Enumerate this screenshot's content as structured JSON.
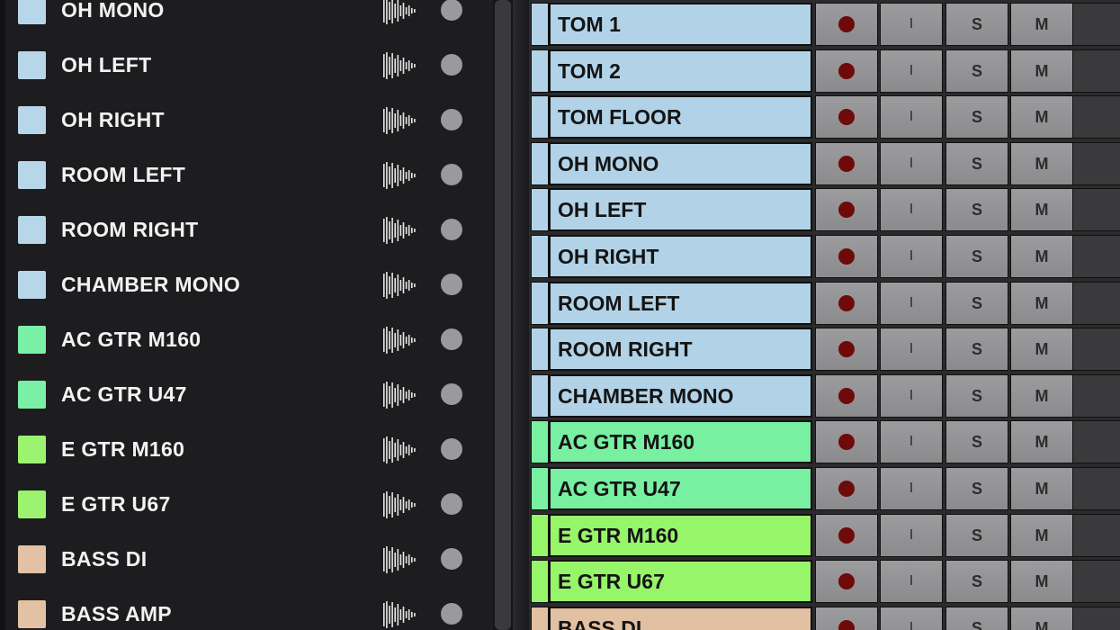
{
  "left_tracks": [
    {
      "name": "OH MONO",
      "color": "#b7d6ea"
    },
    {
      "name": "OH LEFT",
      "color": "#b7d6ea"
    },
    {
      "name": "OH RIGHT",
      "color": "#b7d6ea"
    },
    {
      "name": "ROOM LEFT",
      "color": "#b7d6ea"
    },
    {
      "name": "ROOM RIGHT",
      "color": "#b7d6ea"
    },
    {
      "name": "CHAMBER MONO",
      "color": "#b7d6ea"
    },
    {
      "name": "AC GTR M160",
      "color": "#79f0a6"
    },
    {
      "name": "AC GTR U47",
      "color": "#79f0a6"
    },
    {
      "name": "E GTR M160",
      "color": "#9bf36f"
    },
    {
      "name": "E GTR U67",
      "color": "#9bf36f"
    },
    {
      "name": "BASS DI",
      "color": "#e3c1a4"
    },
    {
      "name": "BASS AMP",
      "color": "#e3c1a4"
    }
  ],
  "left_icons": {
    "waveform": "waveform-icon",
    "status": "status-dot-icon"
  },
  "mixer_tracks": [
    {
      "name": "TOM 1",
      "color": "#b2d3e7"
    },
    {
      "name": "TOM 2",
      "color": "#b2d3e7"
    },
    {
      "name": "TOM FLOOR",
      "color": "#b2d3e7"
    },
    {
      "name": "OH MONO",
      "color": "#b2d3e7"
    },
    {
      "name": "OH LEFT",
      "color": "#b2d3e7"
    },
    {
      "name": "OH RIGHT",
      "color": "#b2d3e7"
    },
    {
      "name": "ROOM LEFT",
      "color": "#b2d3e7"
    },
    {
      "name": "ROOM RIGHT",
      "color": "#b2d3e7"
    },
    {
      "name": "CHAMBER MONO",
      "color": "#b2d3e7"
    },
    {
      "name": "AC GTR M160",
      "color": "#79efa2"
    },
    {
      "name": "AC GTR U47",
      "color": "#79efa2"
    },
    {
      "name": "E GTR M160",
      "color": "#97f56a"
    },
    {
      "name": "E GTR U67",
      "color": "#97f56a"
    },
    {
      "name": "BASS DI",
      "color": "#e2c0a2"
    }
  ],
  "mixer_buttons": {
    "input": "I",
    "solo": "S",
    "mute": "M",
    "record_icon": "record-dot-icon"
  }
}
